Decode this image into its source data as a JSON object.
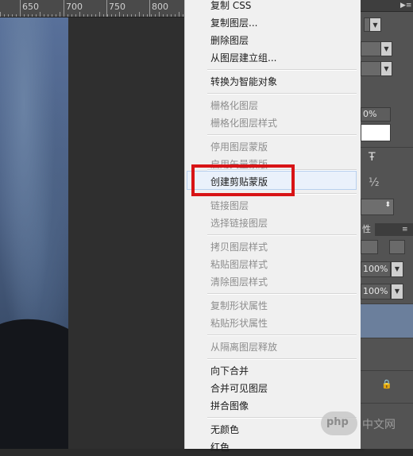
{
  "ruler": {
    "labels": [
      "650",
      "700",
      "750",
      "800"
    ]
  },
  "context_menu": {
    "items": [
      {
        "label": "复制 CSS",
        "enabled": true
      },
      {
        "label": "复制图层...",
        "enabled": true
      },
      {
        "label": "删除图层",
        "enabled": true
      },
      {
        "label": "从图层建立组...",
        "enabled": true
      },
      {
        "label": "转换为智能对象",
        "enabled": true
      },
      {
        "label": "栅格化图层",
        "enabled": false
      },
      {
        "label": "栅格化图层样式",
        "enabled": false
      },
      {
        "label": "停用图层蒙版",
        "enabled": false
      },
      {
        "label": "启用矢量蒙版",
        "enabled": false
      },
      {
        "label": "创建剪贴蒙版",
        "enabled": true,
        "highlighted": true
      },
      {
        "label": "链接图层",
        "enabled": false
      },
      {
        "label": "选择链接图层",
        "enabled": false
      },
      {
        "label": "拷贝图层样式",
        "enabled": false
      },
      {
        "label": "粘贴图层样式",
        "enabled": false
      },
      {
        "label": "清除图层样式",
        "enabled": false
      },
      {
        "label": "复制形状属性",
        "enabled": false
      },
      {
        "label": "粘贴形状属性",
        "enabled": false
      },
      {
        "label": "从隔离图层释放",
        "enabled": false
      },
      {
        "label": "向下合并",
        "enabled": true
      },
      {
        "label": "合并可见图层",
        "enabled": true
      },
      {
        "label": "拼合图像",
        "enabled": true
      },
      {
        "label": "无颜色",
        "enabled": true
      },
      {
        "label": "红色",
        "enabled": true
      }
    ]
  },
  "right_panel": {
    "percent_partial": "0%",
    "type_icon_glyph": "Ŧ",
    "half_glyph": "½",
    "tab_partial": "性",
    "opacity_value": "100%",
    "fill_value": "100%",
    "lock_glyph": "🔒"
  },
  "watermark": {
    "logo": "php",
    "text": "中文网"
  },
  "colors": {
    "highlight_border": "#d81416",
    "menu_bg": "#f0f0f0",
    "panel_bg": "#535353",
    "selected_layer": "#6b7f9c"
  }
}
